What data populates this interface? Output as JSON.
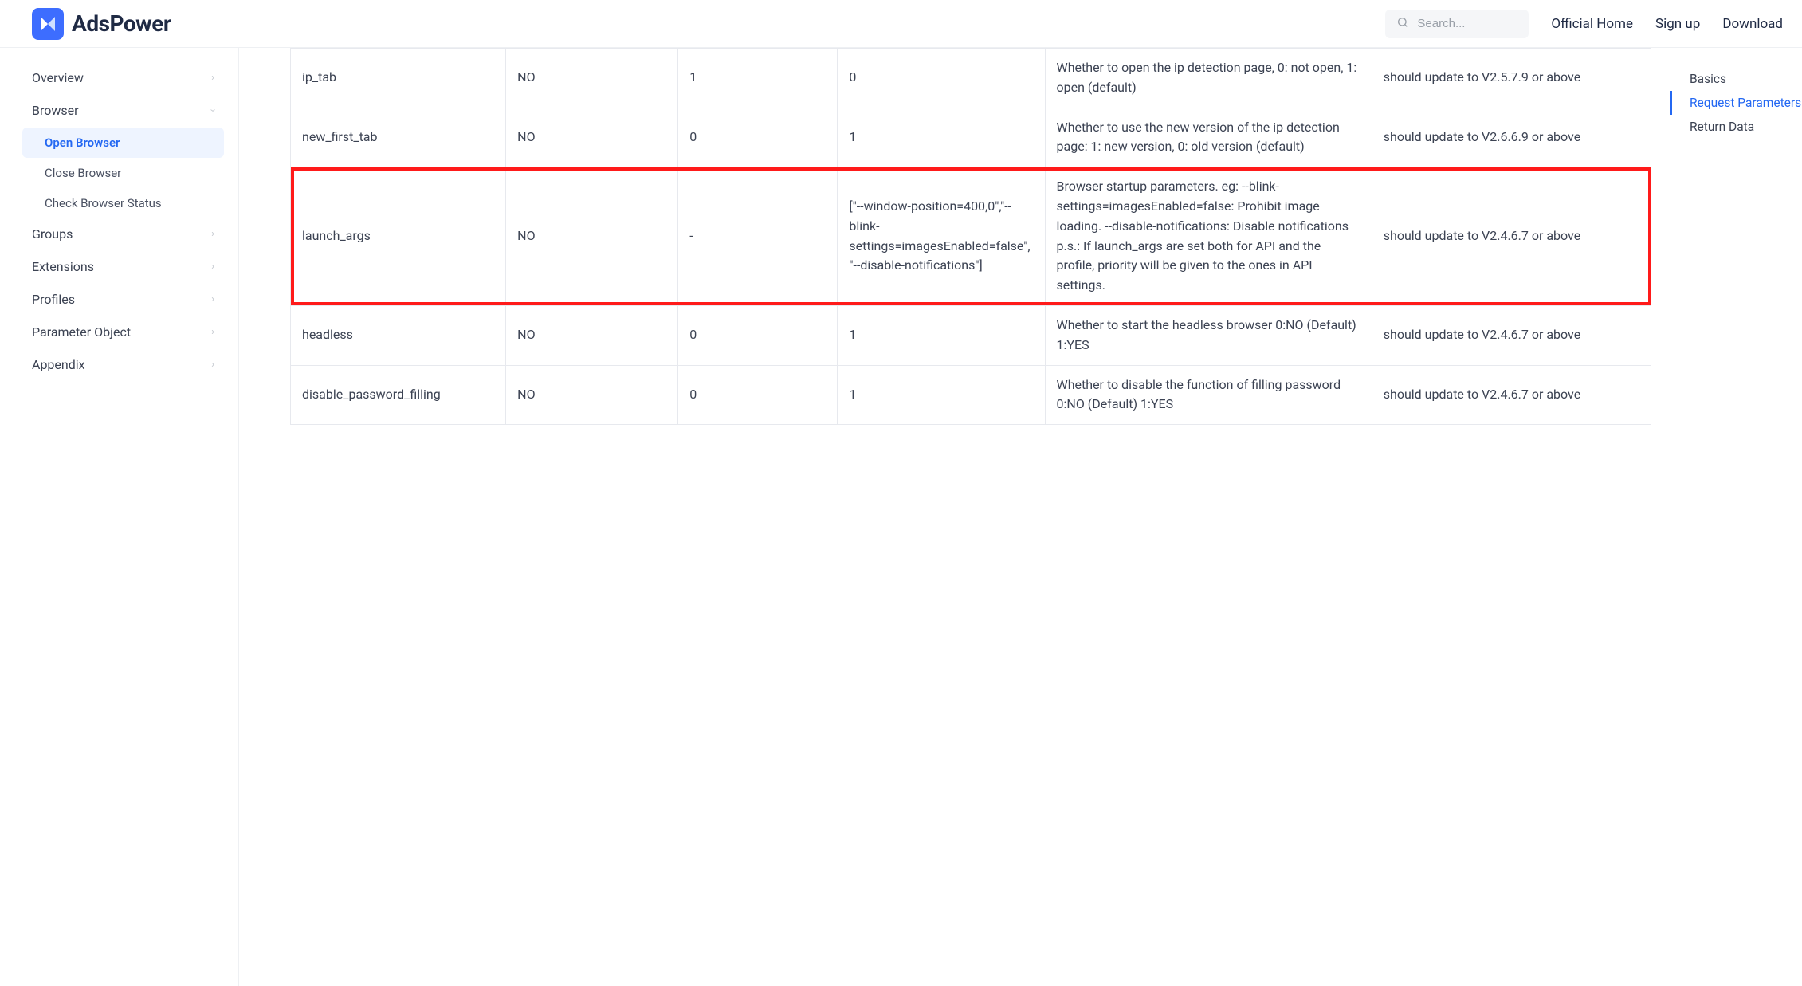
{
  "brand": {
    "name": "AdsPower"
  },
  "header": {
    "search_placeholder": "Search...",
    "links": {
      "official_home": "Official Home",
      "sign_up": "Sign up",
      "download": "Download"
    }
  },
  "sidebar": {
    "items": [
      {
        "label": "Overview",
        "expandable": true
      },
      {
        "label": "Browser",
        "expandable": true,
        "expanded": true,
        "children": [
          {
            "label": "Open Browser",
            "active": true
          },
          {
            "label": "Close Browser",
            "active": false
          },
          {
            "label": "Check Browser Status",
            "active": false
          }
        ]
      },
      {
        "label": "Groups",
        "expandable": true
      },
      {
        "label": "Extensions",
        "expandable": true
      },
      {
        "label": "Profiles",
        "expandable": true
      },
      {
        "label": "Parameter Object",
        "expandable": true
      },
      {
        "label": "Appendix",
        "expandable": true
      }
    ]
  },
  "toc": {
    "items": [
      {
        "label": "Basics",
        "active": false
      },
      {
        "label": "Request Parameters",
        "active": true
      },
      {
        "label": "Return Data",
        "active": false
      }
    ]
  },
  "table": {
    "rows": [
      {
        "name": "ip_tab",
        "required": "NO",
        "default": "1",
        "example": "0",
        "description": "Whether to open the ip detection page, 0: not open, 1: open (default)",
        "note": "should update to V2.5.7.9 or above",
        "highlight": false
      },
      {
        "name": "new_first_tab",
        "required": "NO",
        "default": "0",
        "example": "1",
        "description": "Whether to use the new version of the ip detection page: 1: new version, 0: old version (default)",
        "note": "should update to V2.6.6.9 or above",
        "highlight": false
      },
      {
        "name": "launch_args",
        "required": "NO",
        "default": "-",
        "example": "[\"--window-position=400,0\",\"--blink-settings=imagesEnabled=false\", \"--disable-notifications\"]",
        "description": "Browser startup parameters. eg: --blink-settings=imagesEnabled=false: Prohibit image loading. --disable-notifications: Disable notifications\np.s.: If launch_args are set both for API and the profile, priority will be given to the ones in API settings.",
        "note": "should update to V2.4.6.7 or above",
        "highlight": true
      },
      {
        "name": "headless",
        "required": "NO",
        "default": "0",
        "example": "1",
        "description": "Whether to start the headless browser 0:NO (Default) 1:YES",
        "note": "should update to V2.4.6.7 or above",
        "highlight": false
      },
      {
        "name": "disable_password_filling",
        "required": "NO",
        "default": "0",
        "example": "1",
        "description": "Whether to disable the function of filling password 0:NO (Default) 1:YES",
        "note": "should update to V2.4.6.7 or above",
        "highlight": false
      }
    ]
  }
}
